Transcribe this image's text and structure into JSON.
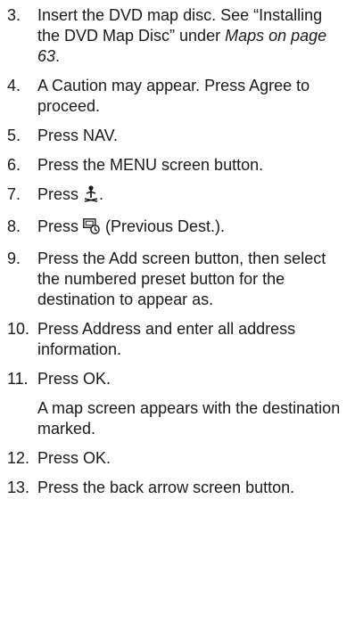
{
  "steps": [
    {
      "num": "3.",
      "parts": [
        {
          "text": "Insert the DVD map disc. See “Installing the DVD Map Disc” under "
        },
        {
          "text": "Maps on page 63",
          "italic": true
        },
        {
          "text": "."
        }
      ]
    },
    {
      "num": "4.",
      "parts": [
        {
          "text": "A Caution may appear. Press Agree to proceed."
        }
      ]
    },
    {
      "num": "5.",
      "parts": [
        {
          "text": "Press NAV."
        }
      ]
    },
    {
      "num": "6.",
      "parts": [
        {
          "text": "Press the MENU screen button."
        }
      ]
    },
    {
      "num": "7.",
      "parts": [
        {
          "text": "Press "
        },
        {
          "icon": "destination-flag-icon"
        },
        {
          "text": "."
        }
      ]
    },
    {
      "num": "8.",
      "parts": [
        {
          "text": "Press "
        },
        {
          "icon": "previous-destination-icon"
        },
        {
          "text": " (Previous Dest.)."
        }
      ]
    },
    {
      "num": "9.",
      "parts": [
        {
          "text": "Press the Add screen button, then select the numbered preset button for the destination to appear as."
        }
      ]
    },
    {
      "num": "10.",
      "parts": [
        {
          "text": "Press Address and enter all address information."
        }
      ]
    },
    {
      "num": "11.",
      "parts": [
        {
          "text": "Press OK."
        }
      ],
      "note": "A map screen appears with the destination marked."
    },
    {
      "num": "12.",
      "parts": [
        {
          "text": "Press OK."
        }
      ]
    },
    {
      "num": "13.",
      "parts": [
        {
          "text": "Press the back arrow screen button."
        }
      ]
    }
  ]
}
